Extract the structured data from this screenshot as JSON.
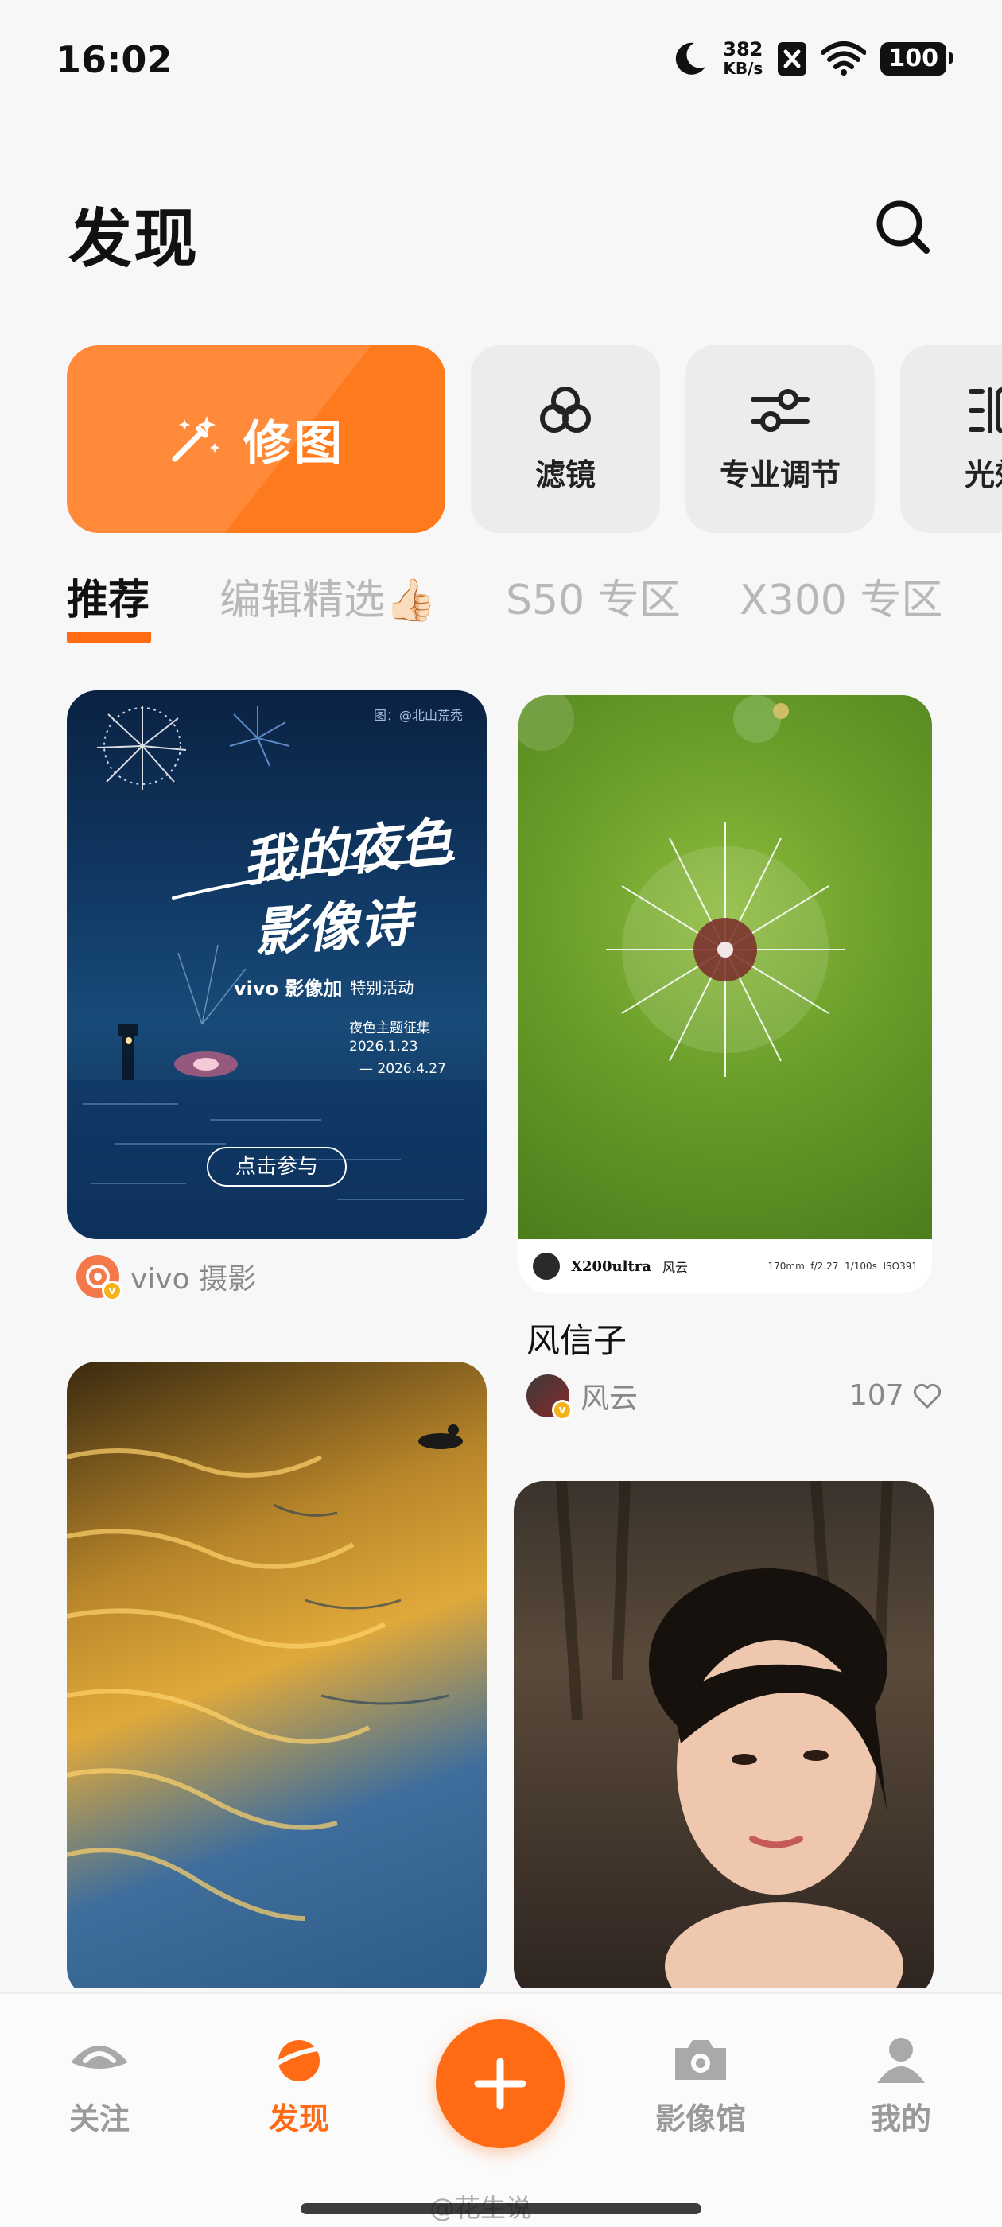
{
  "status_bar": {
    "time": "16:02",
    "net_speed_value": "382",
    "net_speed_unit": "KB/s",
    "battery": "100",
    "icons": [
      "moon-icon",
      "nfc-icon",
      "wifi-icon",
      "battery-icon"
    ]
  },
  "header": {
    "title": "发现",
    "search_icon": "search-icon"
  },
  "tools": {
    "primary": {
      "label": "修图",
      "icon": "magic-wand-icon"
    },
    "items": [
      {
        "label": "滤镜",
        "icon": "filter-circles-icon"
      },
      {
        "label": "专业调节",
        "icon": "sliders-icon"
      },
      {
        "label": "光效",
        "icon": "light-effect-icon"
      }
    ]
  },
  "tabs": [
    {
      "label": "推荐",
      "active": true
    },
    {
      "label": "编辑精选👍🏻",
      "active": false
    },
    {
      "label": "S50 专区",
      "active": false
    },
    {
      "label": "X300 专区",
      "active": false
    }
  ],
  "feed": {
    "card1": {
      "poster_credit": "图：@北山荒秃",
      "poster_title_line1": "我的夜色",
      "poster_title_line2": "影像诗",
      "poster_brand": "vivo 影像加",
      "poster_event": "特别活动",
      "poster_subtitle": "夜色主题征集",
      "poster_date_start": "2026.1.23",
      "poster_date_end": "— 2026.4.27",
      "poster_button": "点击参与",
      "author": "vivo 摄影"
    },
    "card2": {
      "exif_model": "X200ultra",
      "exif_author": "风云",
      "exif_params": "170mm  f/2.27  1/100s  ISO391",
      "title": "风信子",
      "author": "风云",
      "likes": "107"
    }
  },
  "bottom_nav": {
    "items": [
      {
        "label": "关注",
        "icon": "eye-icon",
        "active": false
      },
      {
        "label": "发现",
        "icon": "planet-icon",
        "active": true
      },
      {
        "label": "影像馆",
        "icon": "camera-icon",
        "active": false
      },
      {
        "label": "我的",
        "icon": "profile-icon",
        "active": false
      }
    ],
    "fab_icon": "plus-icon"
  },
  "watermark": "@花生说",
  "colors": {
    "accent": "#ff6a14",
    "tool_primary": "#ff8a3a",
    "tool_bg": "#ececec",
    "page_bg": "#f7f7f7"
  }
}
